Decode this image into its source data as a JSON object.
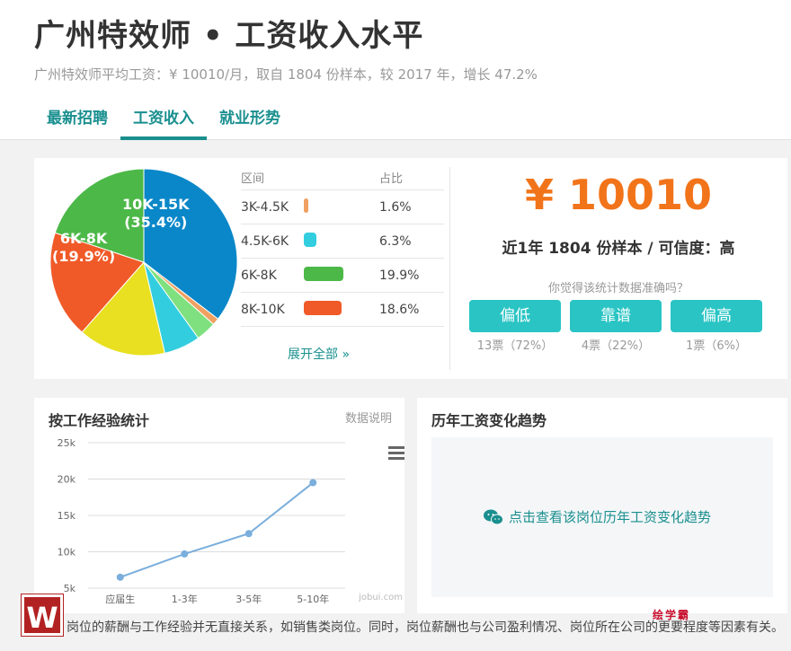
{
  "header": {
    "title": "广州特效师 • 工资收入水平",
    "subtitle": "广州特效师平均工资：¥ 10010/月，取自 1804 份样本，较 2017 年，增长 47.2%"
  },
  "tabs": [
    {
      "label": "最新招聘"
    },
    {
      "label": "工资收入"
    },
    {
      "label": "就业形势"
    }
  ],
  "distribution": {
    "head_range": "区间",
    "head_share": "占比",
    "rows": [
      {
        "range": "3K-4.5K",
        "share": "1.6%",
        "color": "#f0a060",
        "share_value": 1.6
      },
      {
        "range": "4.5K-6K",
        "share": "6.3%",
        "color": "#33cde0",
        "share_value": 6.3
      },
      {
        "range": "6K-8K",
        "share": "19.9%",
        "color": "#4cb848",
        "share_value": 19.9
      },
      {
        "range": "8K-10K",
        "share": "18.6%",
        "color": "#f05a28",
        "share_value": 18.6
      }
    ],
    "expand_label": "展开全部 »",
    "pie_labels": {
      "a": "10K-15K",
      "a_pct": "(35.4%)",
      "b": "6K-8K",
      "b_pct": "(19.9%)"
    }
  },
  "summary": {
    "salary": "¥ 10010",
    "sample": "近1年 1804 份样本 / 可信度：高",
    "question": "你觉得该统计数据准确吗？",
    "votes": [
      {
        "label": "偏低",
        "count": "13票（72%）"
      },
      {
        "label": "靠谱",
        "count": "4票（22%）"
      },
      {
        "label": "偏高",
        "count": "1票（6%）"
      }
    ]
  },
  "experience": {
    "title": "按工作经验统计",
    "link": "数据说明",
    "watermark": "jobui.com"
  },
  "trend": {
    "title": "历年工资变化趋势",
    "link": "点击查看该岗位历年工资变化趋势"
  },
  "footer": {
    "text": "岗位的薪酬与工作经验并无直接关系，如销售类岗位。同时，岗位薪酬也与公司盈利情况、岗位所在公司的更要程度等因素有关。",
    "brand": "绘学霸",
    "logo": "W"
  },
  "chart_data": {
    "type": "line",
    "categories": [
      "应届生",
      "1-3年",
      "3-5年",
      "5-10年"
    ],
    "series": [
      {
        "values": [
          6500,
          9700,
          12500,
          19500
        ]
      }
    ],
    "yticks": [
      "25k",
      "20k",
      "15k",
      "10k",
      "5k"
    ],
    "ylim": [
      5000,
      25000
    ],
    "line_color": "#7aaedc",
    "grid": true
  },
  "pie_data": {
    "slices": [
      {
        "label": "10K-15K",
        "value": 35.4,
        "color": "#0a87c8"
      },
      {
        "label": "other",
        "value": 1.2,
        "color": "#f0a060"
      },
      {
        "label": "other2",
        "value": 3.5,
        "color": "#7ee07e"
      },
      {
        "label": "4.5K-6K",
        "value": 6.3,
        "color": "#33cde0"
      },
      {
        "label": "3K-4.5K",
        "value": 15.1,
        "color": "#e8e020"
      },
      {
        "label": "8K-10K",
        "value": 18.6,
        "color": "#f05a28"
      },
      {
        "label": "6K-8K",
        "value": 19.9,
        "color": "#4cb848"
      }
    ]
  }
}
